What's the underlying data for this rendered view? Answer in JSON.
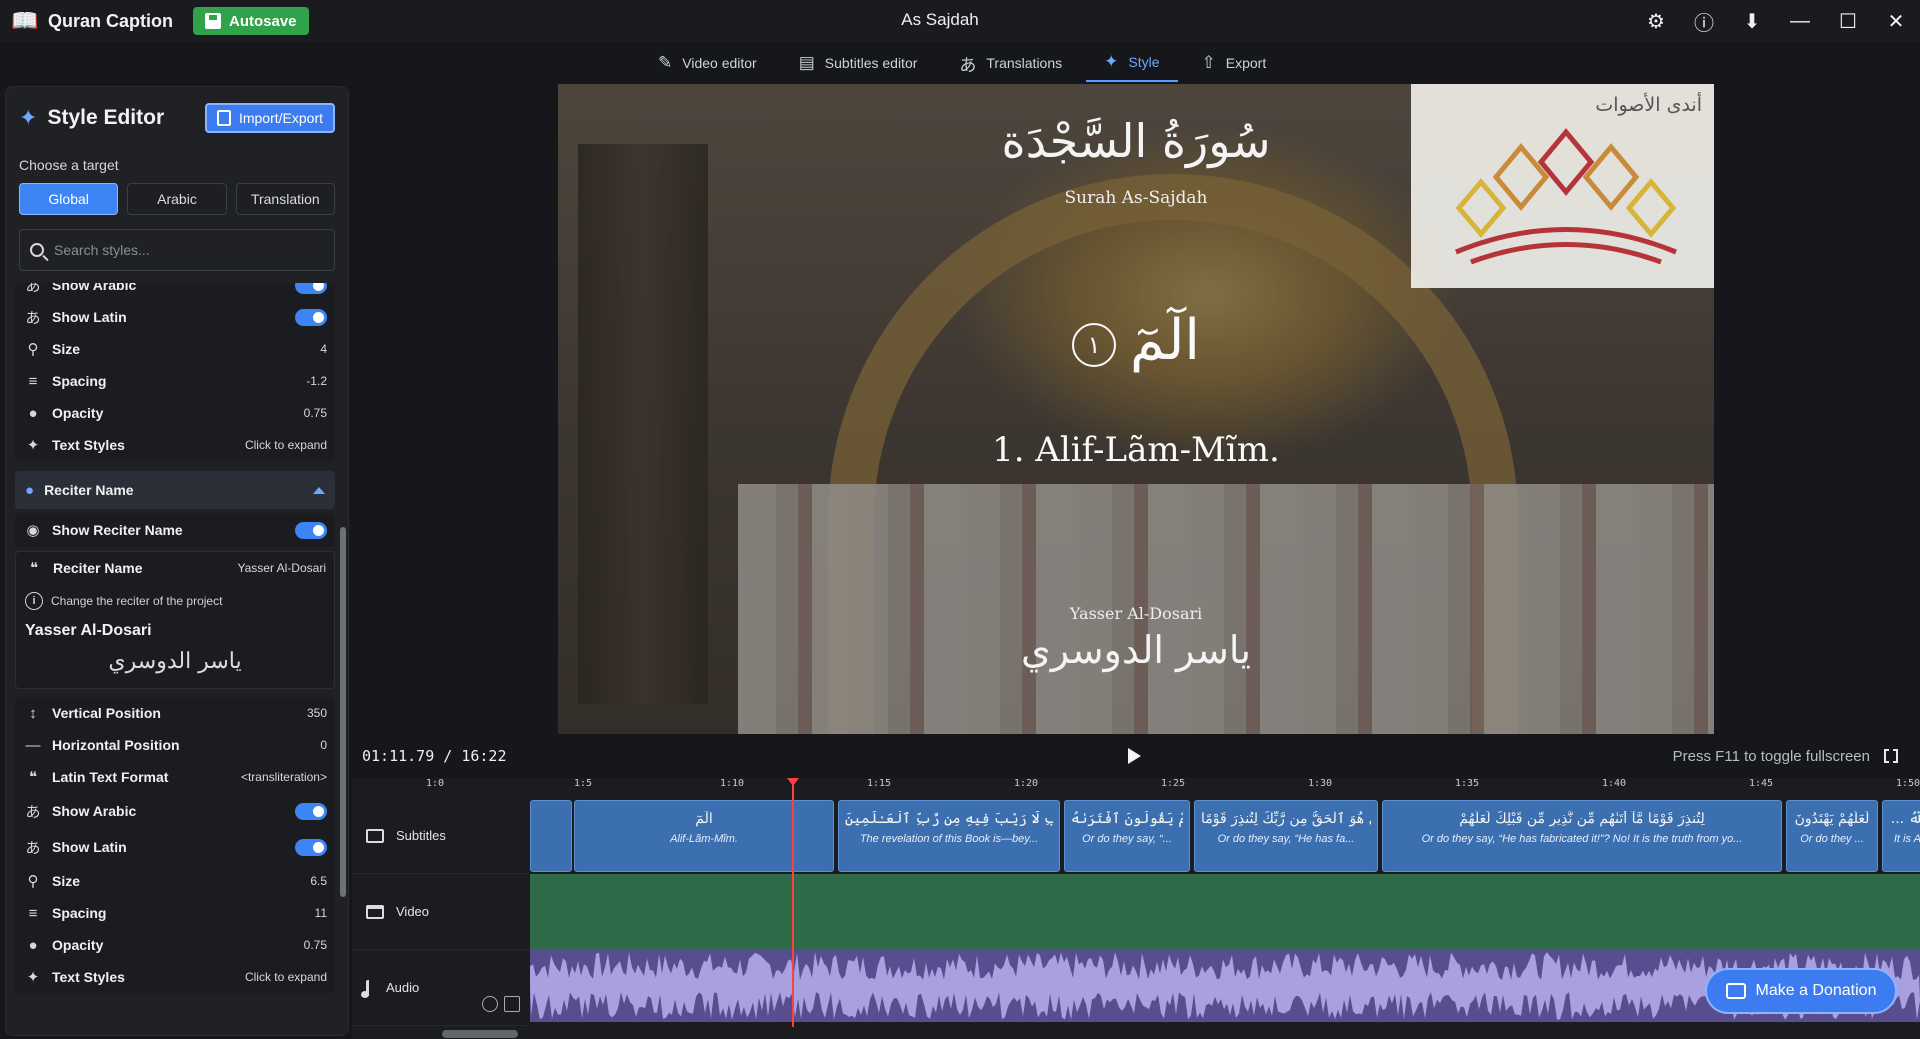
{
  "window": {
    "app_name": "Quran Caption",
    "autosave_label": "Autosave",
    "title": "As Sajdah"
  },
  "tabs": [
    {
      "label": "Video editor",
      "icon": "pencil-icon",
      "active": false
    },
    {
      "label": "Subtitles editor",
      "icon": "subtitles-icon",
      "active": false
    },
    {
      "label": "Translations",
      "icon": "translate-icon",
      "active": false
    },
    {
      "label": "Style",
      "icon": "wand-icon",
      "active": true
    },
    {
      "label": "Export",
      "icon": "export-icon",
      "active": false
    }
  ],
  "style_editor": {
    "title": "Style Editor",
    "import_export_label": "Import/Export",
    "target_label": "Choose a target",
    "targets": [
      "Global",
      "Arabic",
      "Translation"
    ],
    "active_target": "Global",
    "search_placeholder": "Search styles...",
    "upper_group": [
      {
        "label": "Show Arabic",
        "type": "toggle",
        "on": true
      },
      {
        "label": "Show Latin",
        "type": "toggle",
        "on": true
      },
      {
        "label": "Size",
        "type": "value",
        "value": "4"
      },
      {
        "label": "Spacing",
        "type": "value",
        "value": "-1.2"
      },
      {
        "label": "Opacity",
        "type": "value",
        "value": "0.75"
      },
      {
        "label": "Text Styles",
        "type": "value",
        "value": "Click to expand"
      }
    ],
    "reciter_section": {
      "header": "Reciter Name",
      "show_label": "Show Reciter Name",
      "name_label": "Reciter Name",
      "name_value": "Yasser Al-Dosari",
      "info_text": "Change the reciter of the project",
      "reciter_display": "Yasser Al-Dosari",
      "reciter_arabic": "ياسر الدوسري"
    },
    "lower_group": [
      {
        "label": "Vertical Position",
        "type": "value",
        "value": "350"
      },
      {
        "label": "Horizontal Position",
        "type": "value",
        "value": "0"
      },
      {
        "label": "Latin Text Format",
        "type": "value",
        "value": "<transliteration>"
      },
      {
        "label": "Show Arabic",
        "type": "toggle",
        "on": true
      },
      {
        "label": "Show Latin",
        "type": "toggle",
        "on": true
      },
      {
        "label": "Size",
        "type": "value",
        "value": "6.5"
      },
      {
        "label": "Spacing",
        "type": "value",
        "value": "11"
      },
      {
        "label": "Opacity",
        "type": "value",
        "value": "0.75"
      },
      {
        "label": "Text Styles",
        "type": "value",
        "value": "Click to expand"
      }
    ]
  },
  "preview": {
    "surah_arabic": "سُورَةُ السَّجْدَة",
    "surah_english": "Surah As-Sajdah",
    "verse_arabic": "الٓمٓ",
    "verse_number": "١",
    "verse_english": "1. Alif-Lãm-Mĩm.",
    "reciter_english": "Yasser Al-Dosari",
    "reciter_arabic": "ياسر الدوسري",
    "logo_text": "أندى الأصوات"
  },
  "player": {
    "time": "01:11.79 / 16:22",
    "fullscreen_hint": "Press F11 to toggle fullscreen"
  },
  "timeline": {
    "ticks": [
      "1:0",
      "1:5",
      "1:10",
      "1:15",
      "1:20",
      "1:25",
      "1:30",
      "1:35",
      "1:40",
      "1:45",
      "1:50"
    ],
    "tracks": [
      "Subtitles",
      "Video",
      "Audio"
    ],
    "subtitle_clips": [
      {
        "arabic": "",
        "english": ""
      },
      {
        "arabic": "الٓمٓ",
        "english": "Alif-Lãm-Mĩm."
      },
      {
        "arabic": "تَنزِيلُ ٱلْكِتَـٰبِ لَا رَيْبَ فِيهِ مِن رَّبِّ ٱلْعَـٰلَمِينَ",
        "english": "The revelation of this Book is—bey..."
      },
      {
        "arabic": "أَمْ يَقُولُونَ ٱفْتَرَىٰهُ",
        "english": "Or do they say, “..."
      },
      {
        "arabic": "بَلْ هُوَ ٱلْحَقُّ مِن رَّبِّكَ لِتُنذِرَ قَوْمًا",
        "english": "Or do they say, “He has fa..."
      },
      {
        "arabic": "لِتُنذِرَ قَوْمًا مَّآ أَتَىٰهُم مِّن نَّذِيرٍ مِّن قَبْلِكَ لَعَلَّهُمْ",
        "english": "Or do they say, “He has fabricated it!”? No! It is the truth from yo..."
      },
      {
        "arabic": "لَعَلَّهُمْ يَهْتَدُونَ",
        "english": "Or do they ..."
      },
      {
        "arabic": "... ٱللَّهُ",
        "english": "It is A..."
      }
    ]
  },
  "donate_label": "Make a Donation",
  "colors": {
    "accent": "#3d85f5",
    "subtitle_clip": "#3b6fb0",
    "video_track": "#2f6b48",
    "audio_track": "#574d8f",
    "playhead": "#ff4040",
    "autosave": "#2fa24a"
  },
  "playhead_time": "1:11.79"
}
